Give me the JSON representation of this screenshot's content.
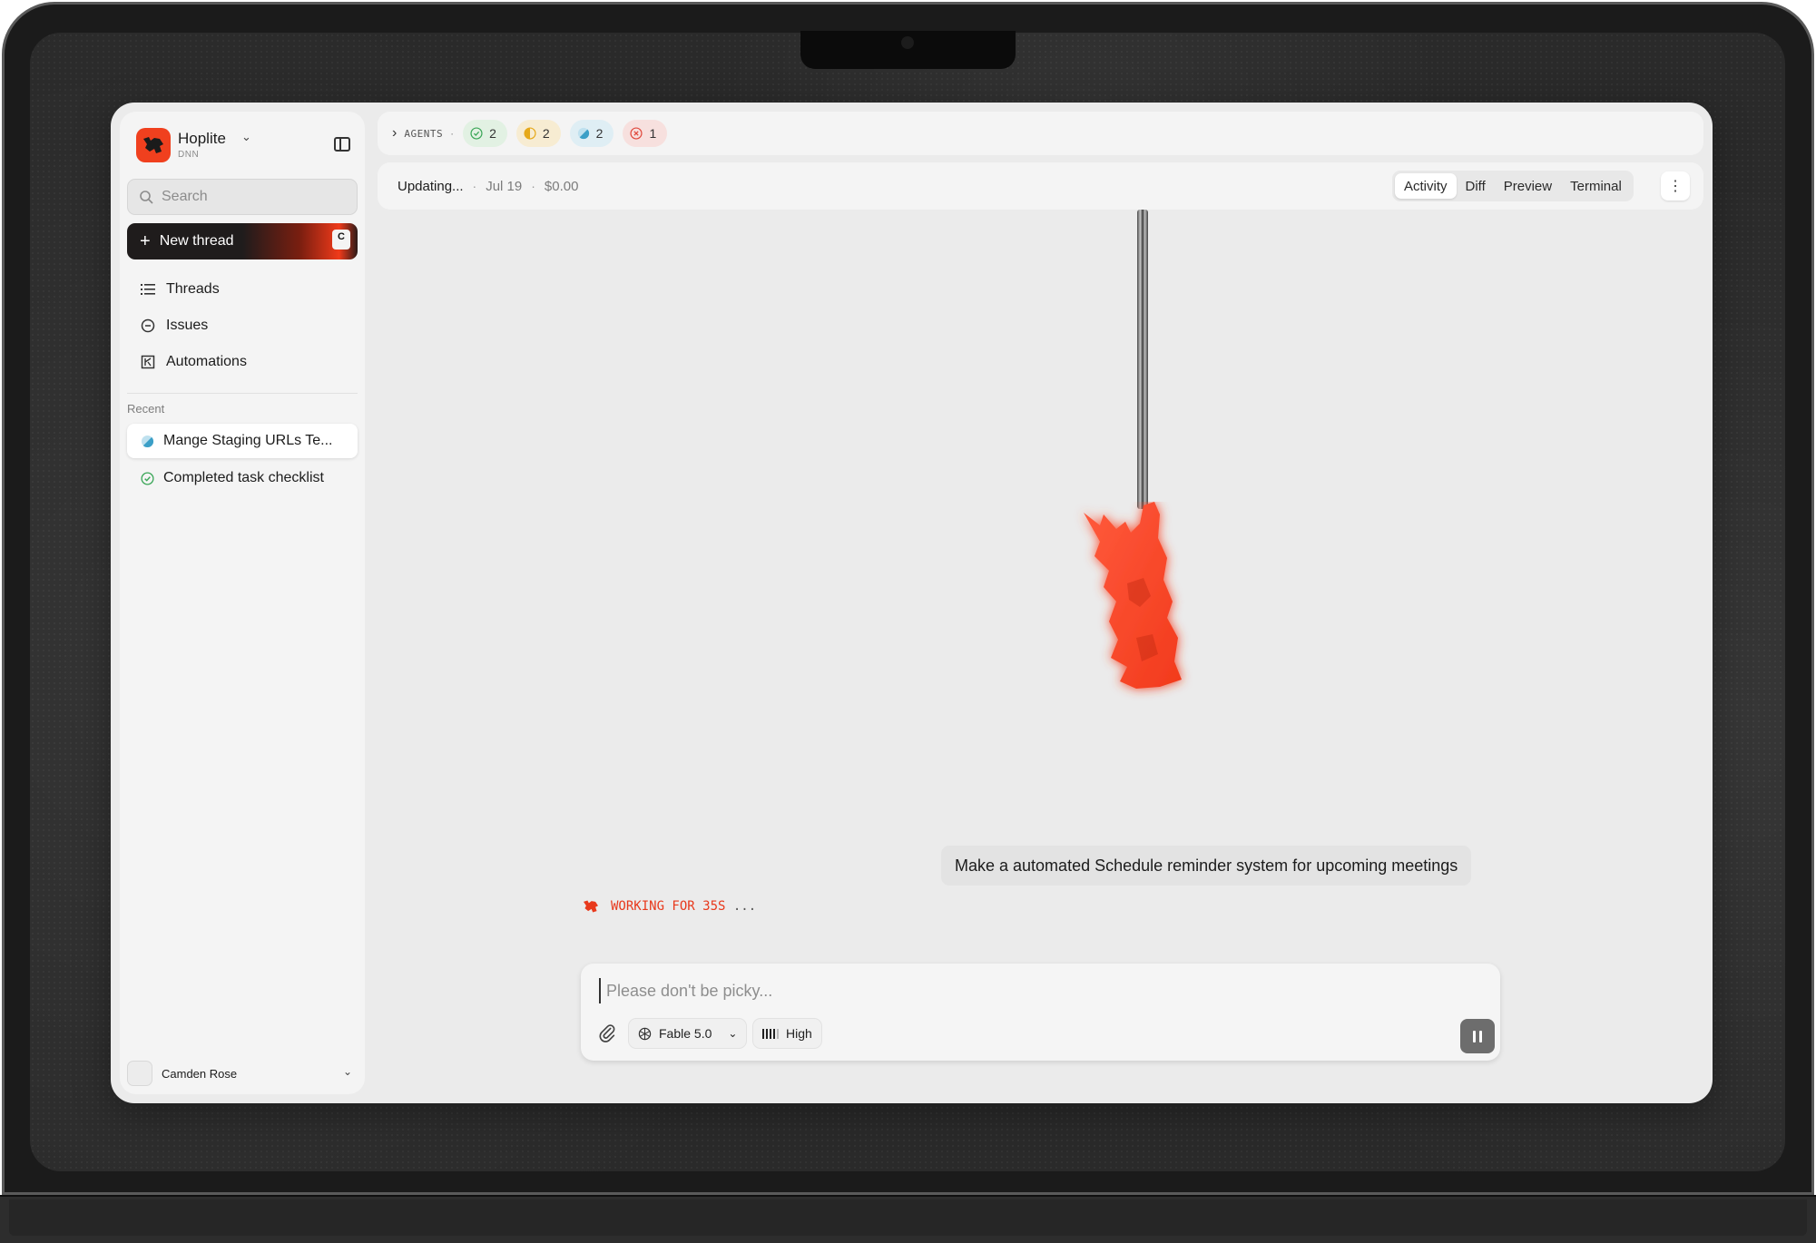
{
  "workspace": {
    "name": "Hoplite",
    "subtitle": "DNN"
  },
  "search": {
    "placeholder": "Search"
  },
  "new_thread": {
    "label": "New thread",
    "shortcut": "C"
  },
  "nav": [
    {
      "label": "Threads",
      "icon": "list-icon"
    },
    {
      "label": "Issues",
      "icon": "circle-minus-icon"
    },
    {
      "label": "Automations",
      "icon": "automation-icon"
    }
  ],
  "recent": {
    "label": "Recent",
    "items": [
      {
        "label": "Mange Staging URLs Te...",
        "status": "in-progress",
        "active": true
      },
      {
        "label": "Completed task checklist",
        "status": "done",
        "active": false
      }
    ]
  },
  "user": {
    "name": "Camden Rose"
  },
  "agents": {
    "label": "AGENTS",
    "counts": [
      {
        "status": "completed",
        "count": "2",
        "color": "#3aa657"
      },
      {
        "status": "paused",
        "count": "2",
        "color": "#e6a91a"
      },
      {
        "status": "running",
        "count": "2",
        "color": "#3b9fc7"
      },
      {
        "status": "failed",
        "count": "1",
        "color": "#e0483c"
      }
    ]
  },
  "status": {
    "state": "Updating...",
    "date": "Jul 19",
    "cost": "$0.00"
  },
  "view_tabs": [
    {
      "label": "Activity",
      "active": true
    },
    {
      "label": "Diff",
      "active": false
    },
    {
      "label": "Preview",
      "active": false
    },
    {
      "label": "Terminal",
      "active": false
    }
  ],
  "conversation": {
    "user_message": "Make a automated Schedule reminder system for upcoming meetings",
    "working_text": "WORKING FOR 35S",
    "working_dots": "..."
  },
  "composer": {
    "placeholder": "Please don't be picky...",
    "model": "Fable 5.0",
    "effort": "High"
  },
  "colors": {
    "brand": "#f0401e",
    "accent_dark": "#1f1c1c"
  }
}
